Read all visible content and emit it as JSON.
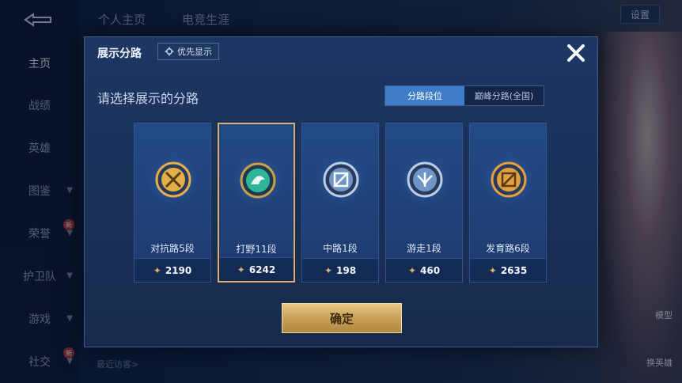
{
  "background": {
    "nav_items": [
      {
        "label": "主页",
        "active": true
      },
      {
        "label": "战绩"
      },
      {
        "label": "英雄"
      },
      {
        "label": "图鉴",
        "chevron": true
      },
      {
        "label": "荣誉",
        "chevron": true,
        "badge": "新"
      },
      {
        "label": "护卫队",
        "chevron": true
      },
      {
        "label": "游戏",
        "chevron": true
      },
      {
        "label": "社交",
        "chevron": true,
        "badge": "新"
      }
    ],
    "top_tabs": [
      "个人主页",
      "电竞生涯"
    ],
    "settings_label": "设置",
    "right_labels": [
      "模型",
      "换英雄"
    ],
    "recent_visitors_label": "最近访客>"
  },
  "modal": {
    "title": "展示分路",
    "priority_label": "优先显示",
    "subtitle": "请选择展示的分路",
    "tabs": [
      {
        "label": "分路段位",
        "active": true
      },
      {
        "label": "巅峰分路(全国)",
        "active": false
      }
    ],
    "cards": [
      {
        "name": "对抗路5段",
        "score": "2190",
        "icon": "clash-lane-badge-icon",
        "color": "#e2b04a",
        "selected": false
      },
      {
        "name": "打野11段",
        "score": "6242",
        "icon": "jungle-badge-icon",
        "color": "#2fb59a",
        "selected": true
      },
      {
        "name": "中路1段",
        "score": "198",
        "icon": "mid-lane-badge-icon",
        "color": "#9ab8d8",
        "selected": false
      },
      {
        "name": "游走1段",
        "score": "460",
        "icon": "roam-badge-icon",
        "color": "#9ab8d8",
        "selected": false
      },
      {
        "name": "发育路6段",
        "score": "2635",
        "icon": "farm-lane-badge-icon",
        "color": "#e2a040",
        "selected": false
      }
    ],
    "confirm_label": "确定"
  },
  "colors": {
    "accent_gold": "#d8ae6a",
    "tab_active": "#3f7dc9",
    "card_bg": "#234a86"
  }
}
